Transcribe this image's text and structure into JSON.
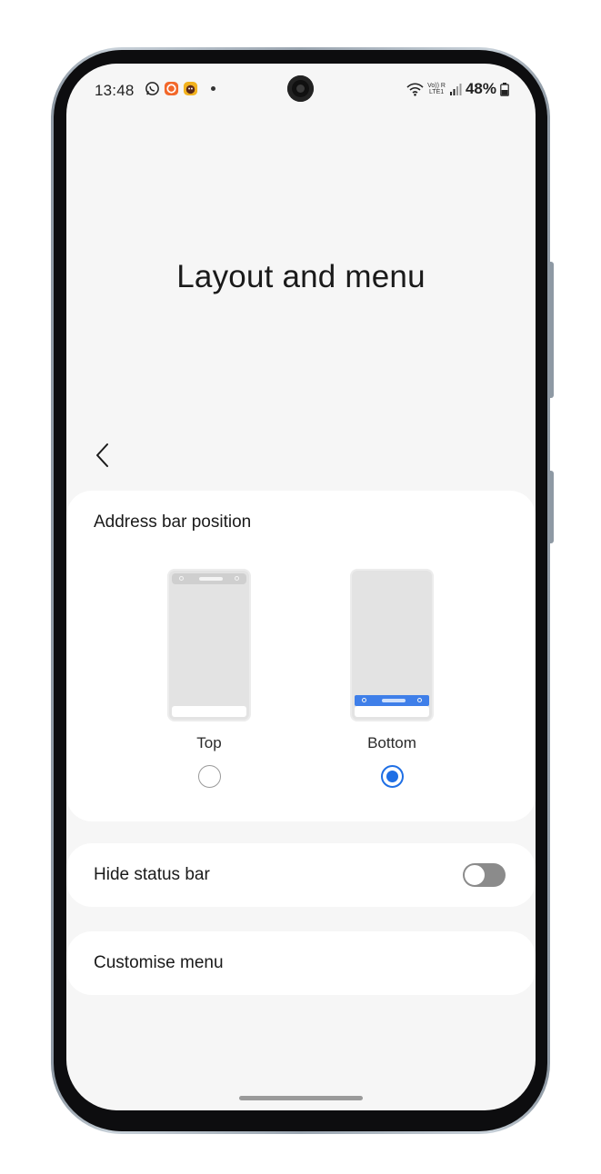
{
  "status_bar": {
    "time": "13:48",
    "battery": "48%",
    "network_top": "Vo)) R",
    "network_bottom": "LTE1",
    "notification_icons": [
      "whatsapp-icon",
      "orange-app-icon",
      "sweet-app-icon"
    ]
  },
  "page": {
    "title": "Layout and menu"
  },
  "address_bar": {
    "label": "Address bar position",
    "options": [
      {
        "label": "Top",
        "selected": false
      },
      {
        "label": "Bottom",
        "selected": true
      }
    ],
    "accent_color": "#1f6fe5"
  },
  "hide_status_bar": {
    "label": "Hide status bar",
    "enabled": false
  },
  "customise_menu": {
    "label": "Customise menu"
  }
}
